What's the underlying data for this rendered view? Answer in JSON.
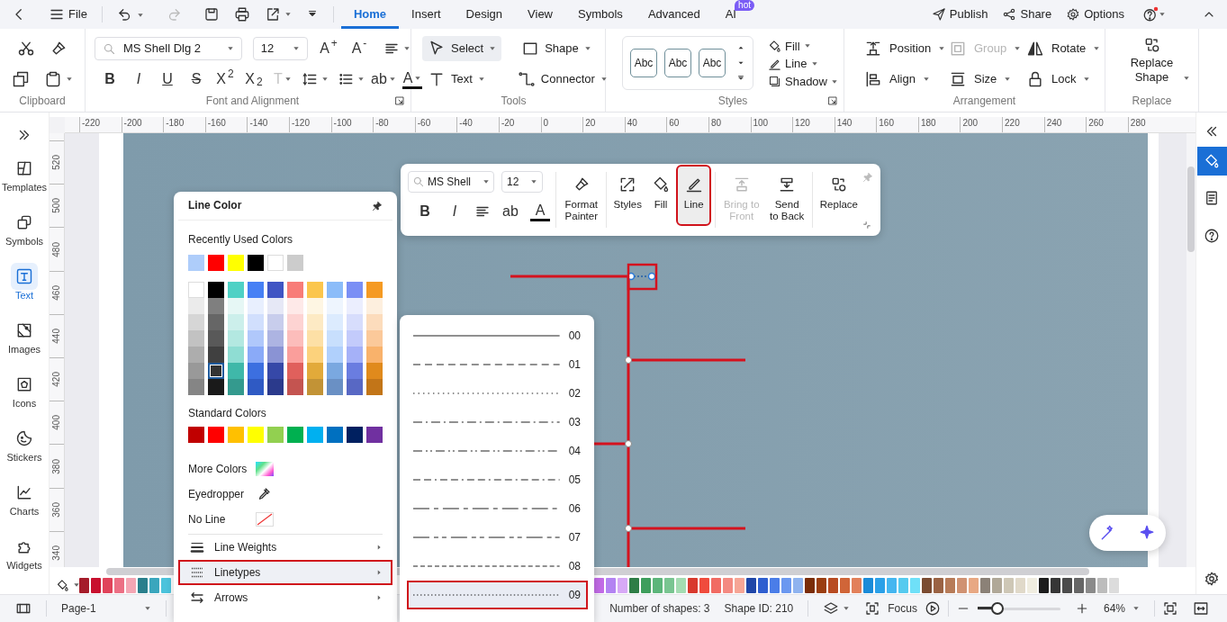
{
  "top_bar": {
    "file": "File",
    "tabs": [
      {
        "label": "Home",
        "selected": true
      },
      {
        "label": "Insert",
        "selected": false
      },
      {
        "label": "Design",
        "selected": false
      },
      {
        "label": "View",
        "selected": false
      },
      {
        "label": "Symbols",
        "selected": false
      },
      {
        "label": "Advanced",
        "selected": false
      },
      {
        "label": "AI",
        "selected": false,
        "badge": "hot"
      }
    ],
    "actions": [
      "Publish",
      "Share",
      "Options"
    ]
  },
  "ribbon": {
    "font_family": "MS Shell Dlg 2",
    "font_size": "12",
    "size_buttons": [
      "A$^{+}$",
      "A$^{-}$"
    ],
    "format_buttons": [
      {
        "kind": "bold",
        "label": "B",
        "dropdown": false
      },
      {
        "kind": "italic",
        "label": "I",
        "dropdown": false
      },
      {
        "kind": "underline",
        "label": "U",
        "dropdown": false
      },
      {
        "kind": "strike",
        "label": "S",
        "dropdown": false
      },
      {
        "kind": "plain",
        "label": "X$^{2}$",
        "dropdown": false
      },
      {
        "kind": "plain",
        "label": "X$_{2}$",
        "dropdown": false
      },
      {
        "kind": "faded",
        "label": "T",
        "dropdown": true
      },
      {
        "kind": "line-spacing",
        "dropdown": true
      },
      {
        "kind": "bullets",
        "dropdown": true
      },
      {
        "kind": "plain",
        "label": "ab",
        "dropdown": true
      },
      {
        "kind": "font-color",
        "label": "A",
        "dropdown": true
      }
    ],
    "tools": [
      {
        "label": "Select",
        "selected": true
      },
      {
        "label": "Shape",
        "selected": false
      },
      {
        "label": "Text",
        "selected": false
      },
      {
        "label": "Connector",
        "selected": false
      }
    ],
    "style_samples": [
      "Abc",
      "Abc",
      "Abc"
    ],
    "style_options": [
      "Fill",
      "Line",
      "Shadow"
    ],
    "arrangement": [
      {
        "label": "Position",
        "disabled": false
      },
      {
        "label": "Align",
        "disabled": false
      },
      {
        "label": "Group",
        "disabled": true
      },
      {
        "label": "Size",
        "disabled": false
      },
      {
        "label": "Rotate",
        "disabled": false
      },
      {
        "label": "Lock",
        "disabled": false
      }
    ],
    "replace": "Replace Shape",
    "group_labels": [
      "Clipboard",
      "Font and Alignment",
      "Tools",
      "Styles",
      "Arrangement",
      "Replace"
    ]
  },
  "sidebar": [
    {
      "label": "Templates",
      "selected": false
    },
    {
      "label": "Symbols",
      "selected": false
    },
    {
      "label": "Text",
      "selected": true
    },
    {
      "label": "Images",
      "selected": false
    },
    {
      "label": "Icons",
      "selected": false
    },
    {
      "label": "Stickers",
      "selected": false
    },
    {
      "label": "Charts",
      "selected": false
    },
    {
      "label": "Widgets",
      "selected": false
    }
  ],
  "rulers": {
    "horizontal": [
      "-220",
      "-200",
      "-180",
      "-160",
      "-140",
      "-120",
      "-100",
      "-80",
      "-60",
      "-40",
      "-20",
      "0",
      "20",
      "40",
      "60",
      "80",
      "100",
      "120",
      "140",
      "160",
      "180",
      "200",
      "220",
      "240",
      "260",
      "280"
    ],
    "vertical": [
      "520",
      "500",
      "480",
      "460",
      "440",
      "420",
      "400",
      "380",
      "360",
      "340"
    ]
  },
  "canvas": {
    "selection_highlighted": true
  },
  "floating_toolbar": {
    "font_family": "MS Shell",
    "font_size": "12",
    "format_buttons": [
      {
        "kind": "bold",
        "label": "B"
      },
      {
        "kind": "italic",
        "label": "I"
      },
      {
        "kind": "align"
      },
      {
        "kind": "plain",
        "label": "ab"
      },
      {
        "kind": "font-color",
        "label": "A"
      }
    ],
    "buttons": [
      {
        "label": "Format Painter",
        "selected": false,
        "disabled": false,
        "highlighted": false
      },
      {
        "label": "Styles",
        "selected": false,
        "disabled": false,
        "highlighted": false
      },
      {
        "label": "Fill",
        "selected": false,
        "disabled": false,
        "highlighted": false
      },
      {
        "label": "Line",
        "selected": true,
        "disabled": false,
        "highlighted": true
      },
      {
        "label": "Bring to Front",
        "selected": false,
        "disabled": true,
        "highlighted": false
      },
      {
        "label": "Send to Back",
        "selected": false,
        "disabled": false,
        "highlighted": false
      },
      {
        "label": "Replace",
        "selected": false,
        "disabled": false,
        "highlighted": false
      }
    ]
  },
  "line_color_panel": {
    "title": "Line Color",
    "recent_label": "Recently Used Colors",
    "recent": [
      {
        "color": "#aecdfa"
      },
      {
        "color": "#ff0000"
      },
      {
        "color": "#ffff00"
      },
      {
        "color": "#000000"
      },
      {
        "color": "#ffffff"
      },
      {
        "color": "#cccccc"
      }
    ],
    "theme_columns": [
      [
        {
          "color": "#ffffff",
          "selected": false
        },
        {
          "color": "#ebebeb",
          "selected": false
        },
        {
          "color": "#d6d6d6",
          "selected": false
        },
        {
          "color": "#c2c2c2",
          "selected": false
        },
        {
          "color": "#adadad",
          "selected": false
        },
        {
          "color": "#999999",
          "selected": false
        },
        {
          "color": "#858585",
          "selected": false
        }
      ],
      [
        {
          "color": "#000000",
          "selected": false
        },
        {
          "color": "#7f7f7f",
          "selected": false
        },
        {
          "color": "#666666",
          "selected": false
        },
        {
          "color": "#595959",
          "selected": false
        },
        {
          "color": "#404040",
          "selected": false
        },
        {
          "color": "#333333",
          "selected": true
        },
        {
          "color": "#1a1a1a",
          "selected": false
        }
      ],
      [
        {
          "color": "#4fd1c5",
          "selected": false
        },
        {
          "color": "#e6f7f5",
          "selected": false
        },
        {
          "color": "#ccefeb",
          "selected": false
        },
        {
          "color": "#b3e8e1",
          "selected": false
        },
        {
          "color": "#8fddd3",
          "selected": false
        },
        {
          "color": "#3fb8a9",
          "selected": false
        },
        {
          "color": "#349a8e",
          "selected": false
        }
      ],
      [
        {
          "color": "#4680f5",
          "selected": false
        },
        {
          "color": "#e8effe",
          "selected": false
        },
        {
          "color": "#d1dffd",
          "selected": false
        },
        {
          "color": "#b0c8fb",
          "selected": false
        },
        {
          "color": "#8aaaf8",
          "selected": false
        },
        {
          "color": "#3c6fe0",
          "selected": false
        },
        {
          "color": "#2f5ac4",
          "selected": false
        }
      ],
      [
        {
          "color": "#4055c4",
          "selected": false
        },
        {
          "color": "#e6e8f6",
          "selected": false
        },
        {
          "color": "#c8cdec",
          "selected": false
        },
        {
          "color": "#adb4e2",
          "selected": false
        },
        {
          "color": "#8a93d4",
          "selected": false
        },
        {
          "color": "#3648a8",
          "selected": false
        },
        {
          "color": "#2b3a8c",
          "selected": false
        }
      ],
      [
        {
          "color": "#f87c78",
          "selected": false
        },
        {
          "color": "#fee9e8",
          "selected": false
        },
        {
          "color": "#fdd3d2",
          "selected": false
        },
        {
          "color": "#fcbdbb",
          "selected": false
        },
        {
          "color": "#fa9e9b",
          "selected": false
        },
        {
          "color": "#e0605c",
          "selected": false
        },
        {
          "color": "#c45450",
          "selected": false
        }
      ],
      [
        {
          "color": "#fbc64d",
          "selected": false
        },
        {
          "color": "#fef6e3",
          "selected": false
        },
        {
          "color": "#fdeac4",
          "selected": false
        },
        {
          "color": "#fde0a6",
          "selected": false
        },
        {
          "color": "#fcd27c",
          "selected": false
        },
        {
          "color": "#e2aa3a",
          "selected": false
        },
        {
          "color": "#c29336",
          "selected": false
        }
      ],
      [
        {
          "color": "#8bbcf9",
          "selected": false
        },
        {
          "color": "#eef5fe",
          "selected": false
        },
        {
          "color": "#dcebfe",
          "selected": false
        },
        {
          "color": "#c8dffd",
          "selected": false
        },
        {
          "color": "#b0d0fc",
          "selected": false
        },
        {
          "color": "#7aa8e0",
          "selected": false
        },
        {
          "color": "#6a90c4",
          "selected": false
        }
      ],
      [
        {
          "color": "#7a8ff5",
          "selected": false
        },
        {
          "color": "#ebeefe",
          "selected": false
        },
        {
          "color": "#d7ddfc",
          "selected": false
        },
        {
          "color": "#c3cbfb",
          "selected": false
        },
        {
          "color": "#a5b1f8",
          "selected": false
        },
        {
          "color": "#6a7de0",
          "selected": false
        },
        {
          "color": "#5868c4",
          "selected": false
        }
      ],
      [
        {
          "color": "#f59a23",
          "selected": false
        },
        {
          "color": "#fdefde",
          "selected": false
        },
        {
          "color": "#fcdcbc",
          "selected": false
        },
        {
          "color": "#fbc99a",
          "selected": false
        },
        {
          "color": "#f9b26b",
          "selected": false
        },
        {
          "color": "#e08a1c",
          "selected": false
        },
        {
          "color": "#c27518",
          "selected": false
        }
      ]
    ],
    "standard_label": "Standard Colors",
    "standard": [
      {
        "color": "#c00000"
      },
      {
        "color": "#ff0000"
      },
      {
        "color": "#ffc000"
      },
      {
        "color": "#ffff00"
      },
      {
        "color": "#92d050"
      },
      {
        "color": "#00b050"
      },
      {
        "color": "#00b0f0"
      },
      {
        "color": "#0070c0"
      },
      {
        "color": "#002060"
      },
      {
        "color": "#7030a0"
      }
    ],
    "options": [
      "More Colors",
      "Eyedropper",
      "No Line"
    ],
    "submenu": [
      {
        "label": "Line Weights",
        "highlighted": false
      },
      {
        "label": "Linetypes",
        "highlighted": true
      },
      {
        "label": "Arrows",
        "highlighted": false
      }
    ]
  },
  "linetypes": [
    {
      "label": "00",
      "kind": "solid",
      "selected": false,
      "highlighted": false
    },
    {
      "label": "01",
      "kind": "dash",
      "selected": false,
      "highlighted": false
    },
    {
      "label": "02",
      "kind": "dot",
      "selected": false,
      "highlighted": false
    },
    {
      "label": "03",
      "kind": "dash-dot",
      "selected": false,
      "highlighted": false
    },
    {
      "label": "04",
      "kind": "dash-dot-dot",
      "selected": false,
      "highlighted": false
    },
    {
      "label": "05",
      "kind": "dash-dash-dot",
      "selected": false,
      "highlighted": false
    },
    {
      "label": "06",
      "kind": "long-short",
      "selected": false,
      "highlighted": false
    },
    {
      "label": "07",
      "kind": "long-short-short",
      "selected": false,
      "highlighted": false
    },
    {
      "label": "08",
      "kind": "short-dash",
      "selected": false,
      "highlighted": false
    },
    {
      "label": "09",
      "kind": "fine-dot",
      "selected": true,
      "highlighted": true
    }
  ],
  "palette": {
    "left": [
      {
        "color": "#a51c2a"
      },
      {
        "color": "#c8102e"
      },
      {
        "color": "#e0435a"
      },
      {
        "color": "#ec6f84"
      },
      {
        "color": "#f4a6b4"
      },
      {
        "color": "#2a7f8c"
      },
      {
        "color": "#3aa6bd"
      },
      {
        "color": "#4bc3dc"
      }
    ],
    "right": [
      {
        "color": "#c26be6"
      },
      {
        "color": "#b383f2"
      },
      {
        "color": "#d7a9f6"
      },
      {
        "color": "#2e7d46"
      },
      {
        "color": "#3e9e5c"
      },
      {
        "color": "#5cb57a"
      },
      {
        "color": "#79c591"
      },
      {
        "color": "#a4dcb2"
      },
      {
        "color": "#d8392e"
      },
      {
        "color": "#f04b3d"
      },
      {
        "color": "#f16b63"
      },
      {
        "color": "#f48a82"
      },
      {
        "color": "#f6a595"
      },
      {
        "color": "#1f46a8"
      },
      {
        "color": "#2f5fd0"
      },
      {
        "color": "#4a7de8"
      },
      {
        "color": "#6b98f0"
      },
      {
        "color": "#8fb3ef"
      },
      {
        "color": "#7a2d08"
      },
      {
        "color": "#9a3d10"
      },
      {
        "color": "#b84b22"
      },
      {
        "color": "#d06538"
      },
      {
        "color": "#e2805a"
      },
      {
        "color": "#1a8bd8"
      },
      {
        "color": "#2ba0e8"
      },
      {
        "color": "#44b6f0"
      },
      {
        "color": "#55caef"
      },
      {
        "color": "#6fe0f8"
      },
      {
        "color": "#7b4b31"
      },
      {
        "color": "#9a6243"
      },
      {
        "color": "#b77b58"
      },
      {
        "color": "#d09272"
      },
      {
        "color": "#e8a883"
      },
      {
        "color": "#8b8177"
      },
      {
        "color": "#b0a898"
      },
      {
        "color": "#cec7b6"
      },
      {
        "color": "#e0d9c9"
      },
      {
        "color": "#f0ede0"
      },
      {
        "color": "#1c1c1c"
      },
      {
        "color": "#363636"
      },
      {
        "color": "#4b4b4b"
      },
      {
        "color": "#666666"
      },
      {
        "color": "#8a8a8a"
      },
      {
        "color": "#bcbcbc"
      },
      {
        "color": "#dcdcdc"
      }
    ]
  },
  "status_bar": {
    "page": "Page-1",
    "shapes": "Number of shapes: 3",
    "shape_id": "Shape ID: 210",
    "focus": "Focus",
    "zoom": {
      "level": 0.24,
      "value": "64%"
    }
  }
}
